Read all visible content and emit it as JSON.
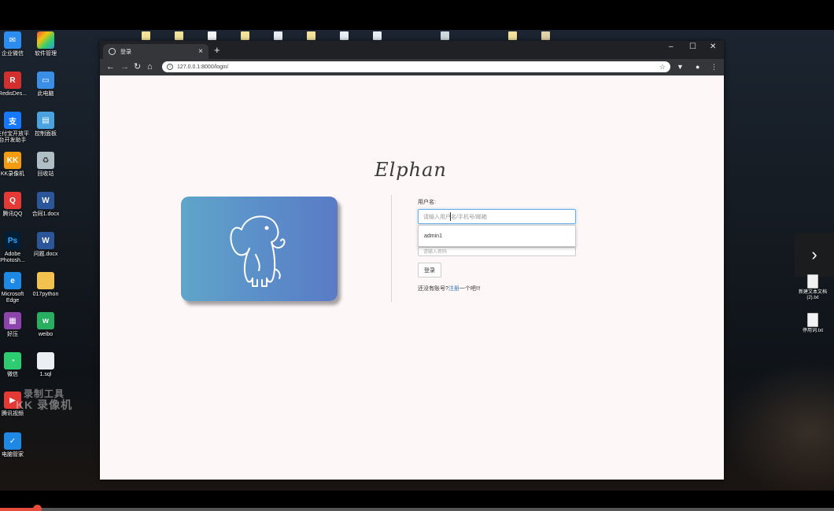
{
  "browser": {
    "tab_title": "登录",
    "tab_close": "×",
    "new_tab": "+",
    "url": "127.0.0.1:8000/login/",
    "window_controls": {
      "minimize": "–",
      "maximize": "☐",
      "close": "✕"
    },
    "nav": {
      "back": "←",
      "forward": "→",
      "reload": "↻",
      "home": "⌂",
      "bookmark": "☆",
      "menu": "⋮"
    }
  },
  "page": {
    "brand": "Elphan",
    "username_label": "用户名:",
    "username_placeholder": "请输入用户名/手机号/邮箱",
    "autocomplete_suggestion": "admin1",
    "password_placeholder": "请输入密码",
    "login_button": "登录",
    "register_prompt": "还没有账号?",
    "register_link": "注册",
    "register_suffix": "一个吧!!!"
  },
  "desktop": {
    "left_icons": [
      {
        "label": "企业微信",
        "color": "#2d8cf0"
      },
      {
        "label": "软件管理",
        "color": "#e84c3d"
      },
      {
        "label": "RedisDes...",
        "color": "#d32f2f"
      },
      {
        "label": "此电脑",
        "color": "#3a8ee6"
      },
      {
        "label": "支付宝开放平台开发助手",
        "color": "#1677ff"
      },
      {
        "label": "控制面板",
        "color": "#4aa3df"
      },
      {
        "label": "KK录像机",
        "color": "#f39c12"
      },
      {
        "label": "回收站",
        "color": "#b0bec5"
      },
      {
        "label": "腾讯QQ",
        "color": "#e53935"
      },
      {
        "label": "合同1.docx",
        "color": "#2b579a"
      },
      {
        "label": "Adobe Photosh...",
        "color": "#001e36"
      },
      {
        "label": "问题.docx",
        "color": "#2b579a"
      },
      {
        "label": "Microsoft Edge",
        "color": "#1e88e5"
      },
      {
        "label": "017python",
        "color": "#f2c14e"
      },
      {
        "label": "好压",
        "color": "#8e44ad"
      },
      {
        "label": "weibo",
        "color": "#27ae60"
      },
      {
        "label": "微信",
        "color": "#2ecc71"
      },
      {
        "label": "1.sql",
        "color": "#eceff1"
      },
      {
        "label": "腾讯视频",
        "color": "#e53935"
      },
      {
        "label": "电脑管家",
        "color": "#1e88e5"
      }
    ],
    "watermark_line1": "录制工具",
    "watermark_line2": "KK 录像机",
    "right_files": [
      {
        "label": "新建文本文档(2).txt"
      },
      {
        "label": "停用词.txt"
      }
    ],
    "next_arrow": "›"
  }
}
